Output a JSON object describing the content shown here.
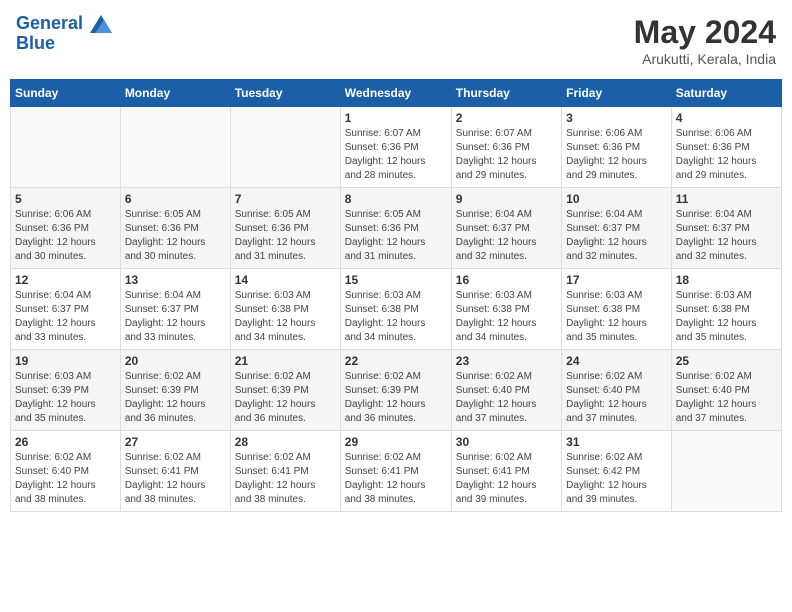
{
  "header": {
    "logo_line1": "General",
    "logo_line2": "Blue",
    "title": "May 2024",
    "subtitle": "Arukutti, Kerala, India"
  },
  "days_of_week": [
    "Sunday",
    "Monday",
    "Tuesday",
    "Wednesday",
    "Thursday",
    "Friday",
    "Saturday"
  ],
  "weeks": [
    [
      {
        "day": "",
        "info": ""
      },
      {
        "day": "",
        "info": ""
      },
      {
        "day": "",
        "info": ""
      },
      {
        "day": "1",
        "info": "Sunrise: 6:07 AM\nSunset: 6:36 PM\nDaylight: 12 hours\nand 28 minutes."
      },
      {
        "day": "2",
        "info": "Sunrise: 6:07 AM\nSunset: 6:36 PM\nDaylight: 12 hours\nand 29 minutes."
      },
      {
        "day": "3",
        "info": "Sunrise: 6:06 AM\nSunset: 6:36 PM\nDaylight: 12 hours\nand 29 minutes."
      },
      {
        "day": "4",
        "info": "Sunrise: 6:06 AM\nSunset: 6:36 PM\nDaylight: 12 hours\nand 29 minutes."
      }
    ],
    [
      {
        "day": "5",
        "info": "Sunrise: 6:06 AM\nSunset: 6:36 PM\nDaylight: 12 hours\nand 30 minutes."
      },
      {
        "day": "6",
        "info": "Sunrise: 6:05 AM\nSunset: 6:36 PM\nDaylight: 12 hours\nand 30 minutes."
      },
      {
        "day": "7",
        "info": "Sunrise: 6:05 AM\nSunset: 6:36 PM\nDaylight: 12 hours\nand 31 minutes."
      },
      {
        "day": "8",
        "info": "Sunrise: 6:05 AM\nSunset: 6:36 PM\nDaylight: 12 hours\nand 31 minutes."
      },
      {
        "day": "9",
        "info": "Sunrise: 6:04 AM\nSunset: 6:37 PM\nDaylight: 12 hours\nand 32 minutes."
      },
      {
        "day": "10",
        "info": "Sunrise: 6:04 AM\nSunset: 6:37 PM\nDaylight: 12 hours\nand 32 minutes."
      },
      {
        "day": "11",
        "info": "Sunrise: 6:04 AM\nSunset: 6:37 PM\nDaylight: 12 hours\nand 32 minutes."
      }
    ],
    [
      {
        "day": "12",
        "info": "Sunrise: 6:04 AM\nSunset: 6:37 PM\nDaylight: 12 hours\nand 33 minutes."
      },
      {
        "day": "13",
        "info": "Sunrise: 6:04 AM\nSunset: 6:37 PM\nDaylight: 12 hours\nand 33 minutes."
      },
      {
        "day": "14",
        "info": "Sunrise: 6:03 AM\nSunset: 6:38 PM\nDaylight: 12 hours\nand 34 minutes."
      },
      {
        "day": "15",
        "info": "Sunrise: 6:03 AM\nSunset: 6:38 PM\nDaylight: 12 hours\nand 34 minutes."
      },
      {
        "day": "16",
        "info": "Sunrise: 6:03 AM\nSunset: 6:38 PM\nDaylight: 12 hours\nand 34 minutes."
      },
      {
        "day": "17",
        "info": "Sunrise: 6:03 AM\nSunset: 6:38 PM\nDaylight: 12 hours\nand 35 minutes."
      },
      {
        "day": "18",
        "info": "Sunrise: 6:03 AM\nSunset: 6:38 PM\nDaylight: 12 hours\nand 35 minutes."
      }
    ],
    [
      {
        "day": "19",
        "info": "Sunrise: 6:03 AM\nSunset: 6:39 PM\nDaylight: 12 hours\nand 35 minutes."
      },
      {
        "day": "20",
        "info": "Sunrise: 6:02 AM\nSunset: 6:39 PM\nDaylight: 12 hours\nand 36 minutes."
      },
      {
        "day": "21",
        "info": "Sunrise: 6:02 AM\nSunset: 6:39 PM\nDaylight: 12 hours\nand 36 minutes."
      },
      {
        "day": "22",
        "info": "Sunrise: 6:02 AM\nSunset: 6:39 PM\nDaylight: 12 hours\nand 36 minutes."
      },
      {
        "day": "23",
        "info": "Sunrise: 6:02 AM\nSunset: 6:40 PM\nDaylight: 12 hours\nand 37 minutes."
      },
      {
        "day": "24",
        "info": "Sunrise: 6:02 AM\nSunset: 6:40 PM\nDaylight: 12 hours\nand 37 minutes."
      },
      {
        "day": "25",
        "info": "Sunrise: 6:02 AM\nSunset: 6:40 PM\nDaylight: 12 hours\nand 37 minutes."
      }
    ],
    [
      {
        "day": "26",
        "info": "Sunrise: 6:02 AM\nSunset: 6:40 PM\nDaylight: 12 hours\nand 38 minutes."
      },
      {
        "day": "27",
        "info": "Sunrise: 6:02 AM\nSunset: 6:41 PM\nDaylight: 12 hours\nand 38 minutes."
      },
      {
        "day": "28",
        "info": "Sunrise: 6:02 AM\nSunset: 6:41 PM\nDaylight: 12 hours\nand 38 minutes."
      },
      {
        "day": "29",
        "info": "Sunrise: 6:02 AM\nSunset: 6:41 PM\nDaylight: 12 hours\nand 38 minutes."
      },
      {
        "day": "30",
        "info": "Sunrise: 6:02 AM\nSunset: 6:41 PM\nDaylight: 12 hours\nand 39 minutes."
      },
      {
        "day": "31",
        "info": "Sunrise: 6:02 AM\nSunset: 6:42 PM\nDaylight: 12 hours\nand 39 minutes."
      },
      {
        "day": "",
        "info": ""
      }
    ]
  ]
}
